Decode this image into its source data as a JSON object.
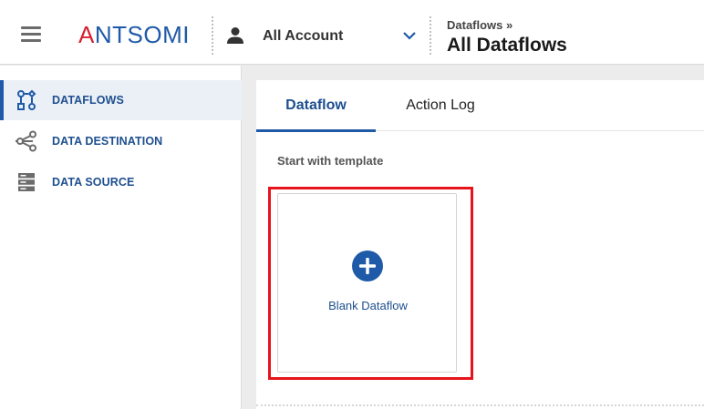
{
  "header": {
    "logo_text_prefix": "",
    "logo_text_accent": "A",
    "logo_text_rest": "NTSOMI",
    "account": {
      "icon": "person-icon",
      "label": "All Account",
      "chevron": "chevron-down-icon"
    },
    "breadcrumb_parent": "Dataflows »",
    "page_title": "All Dataflows"
  },
  "sidebar": {
    "items": [
      {
        "label": "DATAFLOWS",
        "icon": "dataflow-icon",
        "active": true
      },
      {
        "label": "DATA DESTINATION",
        "icon": "share-nodes-icon",
        "active": false
      },
      {
        "label": "DATA SOURCE",
        "icon": "server-icon",
        "active": false
      }
    ]
  },
  "main": {
    "tabs": [
      {
        "label": "Dataflow",
        "active": true
      },
      {
        "label": "Action Log",
        "active": false
      }
    ],
    "section_title": "Start with template",
    "templates": [
      {
        "label": "Blank Dataflow",
        "icon": "plus-circle-icon"
      }
    ]
  },
  "colors": {
    "brand_blue": "#1f5aa8",
    "brand_red": "#d72030",
    "highlight_red": "#e8141c",
    "active_nav_bg": "#ebeff6"
  }
}
